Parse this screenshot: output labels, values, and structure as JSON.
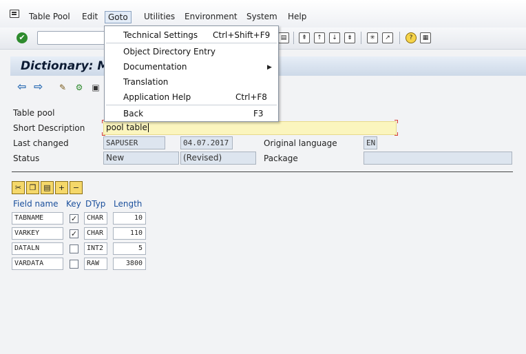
{
  "menubar": {
    "items": [
      "Table Pool",
      "Edit",
      "Goto",
      "Utilities",
      "Environment",
      "System",
      "Help"
    ],
    "active": "Goto"
  },
  "title": "Dictionary: Ma",
  "goto_menu": {
    "items": [
      {
        "label": "Technical Settings",
        "shortcut": "Ctrl+Shift+F9"
      },
      {
        "label": "Object Directory Entry",
        "shortcut": ""
      },
      {
        "label": "Documentation",
        "shortcut": "",
        "submenu": true
      },
      {
        "label": "Translation",
        "shortcut": ""
      },
      {
        "label": "Application Help",
        "shortcut": "Ctrl+F8"
      },
      {
        "label": "Back",
        "shortcut": "F3"
      }
    ]
  },
  "form": {
    "table_pool_label": "Table pool",
    "short_desc_label": "Short Description",
    "short_desc_value": "pool table",
    "last_changed_label": "Last changed",
    "last_changed_user": "SAPUSER",
    "last_changed_date": "04.07.2017",
    "orig_lang_label": "Original language",
    "orig_lang_value": "EN",
    "status_label": "Status",
    "status_value": "New",
    "status_revised": "(Revised)",
    "package_label": "Package",
    "package_value": ""
  },
  "table": {
    "headers": [
      "Field name",
      "Key",
      "DTyp",
      "Length"
    ],
    "rows": [
      {
        "field": "TABNAME",
        "key": true,
        "dtyp": "CHAR",
        "length": "10"
      },
      {
        "field": "VARKEY",
        "key": true,
        "dtyp": "CHAR",
        "length": "110"
      },
      {
        "field": "DATALN",
        "key": false,
        "dtyp": "INT2",
        "length": "5"
      },
      {
        "field": "VARDATA",
        "key": false,
        "dtyp": "RAW",
        "length": "3800"
      }
    ]
  },
  "icons": {
    "check": "✔",
    "back_arrow": "⇦",
    "forward_arrow": "⇨",
    "checkmark_char": "✓"
  }
}
